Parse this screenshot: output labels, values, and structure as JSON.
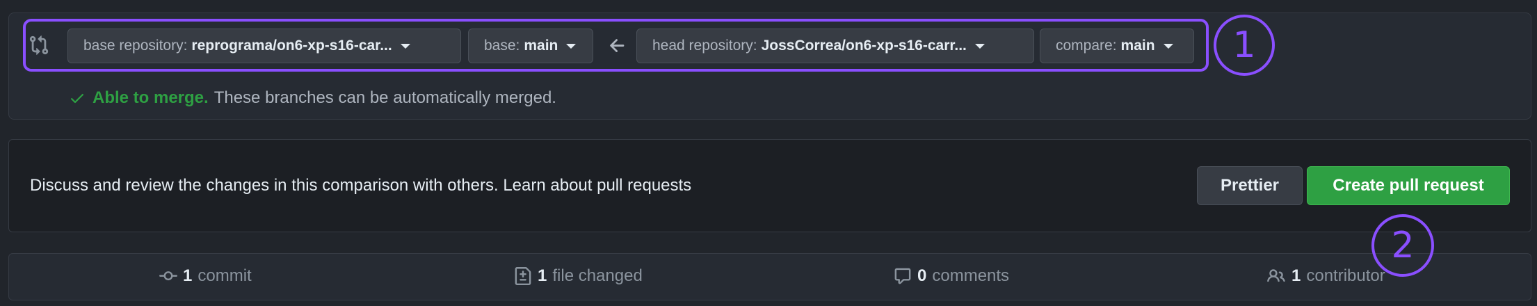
{
  "compare": {
    "base_repository_label": "base repository:",
    "base_repository_value": "reprograma/on6-xp-s16-car...",
    "base_label": "base:",
    "base_value": "main",
    "head_repository_label": "head repository:",
    "head_repository_value": "JossCorrea/on6-xp-s16-carr...",
    "compare_label": "compare:",
    "compare_value": "main",
    "merge_status": "Able to merge.",
    "merge_detail": "These branches can be automatically merged."
  },
  "annotations": {
    "marker_1": "1",
    "marker_2": "2",
    "color": "#8a4fff"
  },
  "pr_bar": {
    "description": "Discuss and review the changes in this comparison with others. Learn about pull requests",
    "prettier_label": "Prettier",
    "create_label": "Create pull request"
  },
  "stats": {
    "commits_count": "1",
    "commits_label": "commit",
    "files_count": "1",
    "files_label": "file changed",
    "comments_count": "0",
    "comments_label": "comments",
    "contributors_count": "1",
    "contributors_label": "contributor"
  },
  "colors": {
    "accent_green": "#2ea043",
    "background": "#21252b"
  },
  "icons": [
    "git-compare-icon",
    "arrow-left-icon",
    "check-icon",
    "git-commit-icon",
    "file-diff-icon",
    "comment-icon",
    "people-icon"
  ]
}
